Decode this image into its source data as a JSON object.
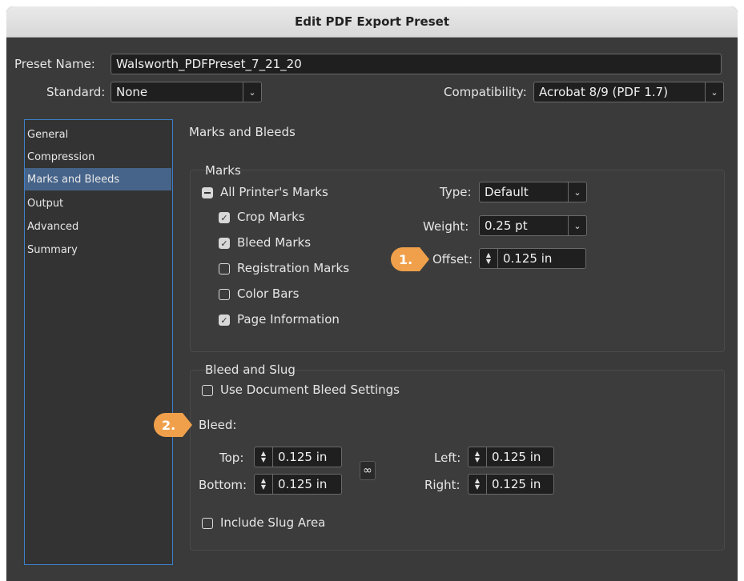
{
  "title": "Edit PDF Export Preset",
  "preset_name": {
    "label": "Preset Name:",
    "value": "Walsworth_PDFPreset_7_21_20"
  },
  "standard": {
    "label": "Standard:",
    "value": "None"
  },
  "compatibility": {
    "label": "Compatibility:",
    "value": "Acrobat 8/9 (PDF 1.7)"
  },
  "sidebar": {
    "items": [
      {
        "label": "General"
      },
      {
        "label": "Compression"
      },
      {
        "label": "Marks and Bleeds",
        "selected": true
      },
      {
        "label": "Output"
      },
      {
        "label": "Advanced"
      },
      {
        "label": "Summary"
      }
    ],
    "selection_color": "#46648a",
    "border_color": "#3d7fc9"
  },
  "section_title": "Marks and Bleeds",
  "marks": {
    "group_title": "Marks",
    "all_printers_marks": {
      "label": "All Printer's Marks",
      "state": "mixed"
    },
    "crop_marks": {
      "label": "Crop Marks",
      "checked": true
    },
    "bleed_marks": {
      "label": "Bleed Marks",
      "checked": true
    },
    "registration_marks": {
      "label": "Registration Marks",
      "checked": false
    },
    "color_bars": {
      "label": "Color Bars",
      "checked": false
    },
    "page_information": {
      "label": "Page Information",
      "checked": true
    },
    "type": {
      "label": "Type:",
      "value": "Default"
    },
    "weight": {
      "label": "Weight:",
      "value": "0.25 pt"
    },
    "offset": {
      "label": "Offset:",
      "value": "0.125 in"
    }
  },
  "bleed_slug": {
    "group_title": "Bleed and Slug",
    "use_document_bleed": {
      "label": "Use Document Bleed Settings",
      "checked": false
    },
    "bleed_label": "Bleed:",
    "top": {
      "label": "Top:",
      "value": "0.125 in"
    },
    "bottom": {
      "label": "Bottom:",
      "value": "0.125 in"
    },
    "left": {
      "label": "Left:",
      "value": "0.125 in"
    },
    "right": {
      "label": "Right:",
      "value": "0.125 in"
    },
    "include_slug": {
      "label": "Include Slug Area",
      "checked": false
    }
  },
  "callouts": {
    "one": "1.",
    "two": "2.",
    "color": "#f0a04b"
  },
  "icons": {
    "chevron": "chevron-down-icon",
    "stepper": "stepper-arrows-icon",
    "link": "chain-link-icon"
  }
}
